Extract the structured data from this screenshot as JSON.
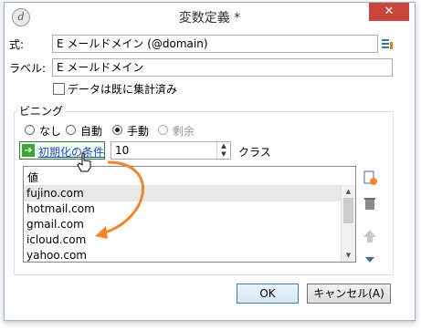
{
  "window": {
    "title": "変数定義 *",
    "close_label": "✕"
  },
  "expression": {
    "label": "式:",
    "value": "E メールドメイン (@domain)"
  },
  "label_field": {
    "label": "ラベル:",
    "value": "E メールドメイン"
  },
  "already_aggregated": {
    "label": "データは既に集計済み",
    "checked": false
  },
  "binning": {
    "group_title": "ビニング",
    "options": [
      {
        "label": "なし",
        "selected": false,
        "enabled": true
      },
      {
        "label": "自動",
        "selected": false,
        "enabled": true
      },
      {
        "label": "手動",
        "selected": true,
        "enabled": true
      },
      {
        "label": "剰余",
        "selected": false,
        "enabled": false
      }
    ],
    "init_conditions_link": "初期化の条件",
    "class_count": "10",
    "class_unit": "クラス"
  },
  "value_list": {
    "column_header": "値",
    "rows": [
      "fujino.com",
      "hotmail.com",
      "gmail.com",
      "icloud.com",
      "yahoo.com"
    ],
    "selected_row": 0
  },
  "side_toolbar": {
    "icons": [
      "add-value-icon",
      "delete-icon",
      "move-up-icon",
      "move-down-icon"
    ]
  },
  "buttons": {
    "ok_label": "OK",
    "cancel_label": "キャンセル(A)"
  },
  "colors": {
    "close_button": "#c7473d",
    "link": "#1a52c2",
    "annotation_arrow": "#f0862b",
    "init_icon": "#3aa63a"
  }
}
